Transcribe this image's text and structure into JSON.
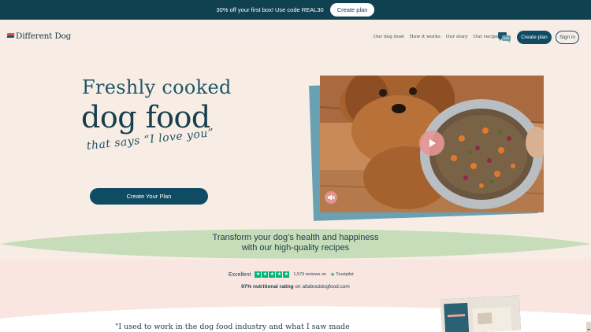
{
  "promo": {
    "text": "30% off your first box! Use code REAL30",
    "button_label": "Create plan"
  },
  "brand": {
    "name": "Different Dog"
  },
  "nav": {
    "items": [
      {
        "label": "Our dog food"
      },
      {
        "label": "How it works"
      },
      {
        "label": "Our story"
      },
      {
        "label": "Our recipes"
      }
    ],
    "create_plan_label": "Create plan",
    "sign_in_label": "Sign in"
  },
  "hero": {
    "line1": "Freshly cooked",
    "line2": "dog food",
    "line3": "that says “I love you”",
    "cta_label": "Create Your Plan"
  },
  "benefit": {
    "line1": "Transform your dog’s health and happiness",
    "line2": "with our high-quality recipes"
  },
  "trustpilot": {
    "rating_word": "Excellent",
    "reviews": "1,579 reviews on",
    "brand": "Trustpilot",
    "stars": 5
  },
  "nutrition": {
    "bold": "97% nutritional rating",
    "rest": " on allaboutdogfood.com"
  },
  "testimonial": {
    "quote": "\"I used to work in the dog food industry and what I saw made"
  },
  "colors": {
    "brand_dark": "#0f4150",
    "button": "#0f4c63",
    "wave_green": "#c7dcb8",
    "trustpilot_green": "#00b67a",
    "play_pink": "#e89696"
  }
}
